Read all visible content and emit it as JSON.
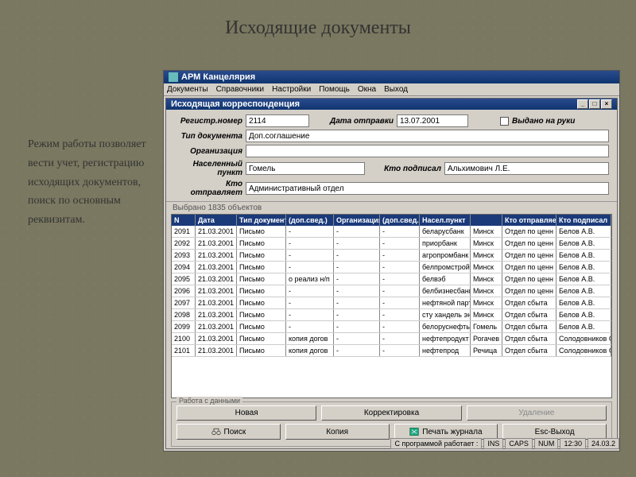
{
  "slide": {
    "title": "Исходящие документы",
    "text": "Режим работы позволяет вести учет, регистрацию исходящих документов, поиск по основным реквизитам."
  },
  "app_title": "АРМ Канцелярия",
  "menu": [
    "Документы",
    "Справочники",
    "Настройки",
    "Помощь",
    "Окна",
    "Выход"
  ],
  "sub_title": "Исходящая корреспонденция",
  "form": {
    "reg_num_lbl": "Регистр.номер",
    "reg_num": "2114",
    "date_lbl": "Дата отправки",
    "date": "13.07.2001",
    "hand_lbl": "Выдано на руки",
    "doc_type_lbl": "Тип документа",
    "doc_type": "Доп.соглашение",
    "org_lbl": "Организация",
    "org": "",
    "city_lbl": "Населенный пункт",
    "city": "Гомель",
    "signer_lbl": "Кто подписал",
    "signer": "Альхимович Л.Е.",
    "sender_lbl": "Кто отправляет",
    "sender": "Административный отдел"
  },
  "grid_status": "Выбрано 1835 объектов",
  "columns": [
    "N",
    "Дата",
    "Тип документа",
    "(доп.свед.)",
    "Организация",
    "(доп.свед.)",
    "Насел.пункт",
    "Кто отправляет",
    "Кто подписал"
  ],
  "rows": [
    {
      "n": "2091",
      "d": "21.03.2001",
      "t": "Письмо",
      "e1": "",
      "o": "",
      "e2": "",
      "c": "беларусбанк",
      "p": "Минск",
      "s": "Отдел по ценн",
      "k": "Белов А.В."
    },
    {
      "n": "2092",
      "d": "21.03.2001",
      "t": "Письмо",
      "e1": "",
      "o": "",
      "e2": "",
      "c": "приорбанк",
      "p": "Минск",
      "s": "Отдел по ценн",
      "k": "Белов А.В."
    },
    {
      "n": "2093",
      "d": "21.03.2001",
      "t": "Письмо",
      "e1": "",
      "o": "",
      "e2": "",
      "c": "агропромбанк",
      "p": "Минск",
      "s": "Отдел по ценн",
      "k": "Белов А.В."
    },
    {
      "n": "2094",
      "d": "21.03.2001",
      "t": "Письмо",
      "e1": "",
      "o": "",
      "e2": "",
      "c": "белпромстрой",
      "p": "Минск",
      "s": "Отдел по ценн",
      "k": "Белов А.В."
    },
    {
      "n": "2095",
      "d": "21.03.2001",
      "t": "Письмо",
      "e1": "о реализ н/п",
      "o": "",
      "e2": "",
      "c": "белвэб",
      "p": "Минск",
      "s": "Отдел по ценн",
      "k": "Белов А.В."
    },
    {
      "n": "2096",
      "d": "21.03.2001",
      "t": "Письмо",
      "e1": "",
      "o": "",
      "e2": "",
      "c": "белбизнесбанк",
      "p": "Минск",
      "s": "Отдел по ценн",
      "k": "Белов А.В."
    },
    {
      "n": "2097",
      "d": "21.03.2001",
      "t": "Письмо",
      "e1": "",
      "o": "",
      "e2": "",
      "c": "нефтяной парт",
      "p": "Минск",
      "s": "Отдел сбыта",
      "k": "Белов А.В."
    },
    {
      "n": "2098",
      "d": "21.03.2001",
      "t": "Письмо",
      "e1": "",
      "o": "",
      "e2": "",
      "c": "сту хандель эн",
      "p": "Минск",
      "s": "Отдел сбыта",
      "k": "Белов А.В."
    },
    {
      "n": "2099",
      "d": "21.03.2001",
      "t": "Письмо",
      "e1": "",
      "o": "",
      "e2": "",
      "c": "белоруснефть",
      "p": "Гомель",
      "s": "Отдел сбыта",
      "k": "Белов А.В."
    },
    {
      "n": "2100",
      "d": "21.03.2001",
      "t": "Письмо",
      "e1": "копия догов",
      "o": "",
      "e2": "",
      "c": "нефтепродукт",
      "p": "Рогачев",
      "s": "Отдел сбыта",
      "k": "Солодовников С.Л."
    },
    {
      "n": "2101",
      "d": "21.03.2001",
      "t": "Письмо",
      "e1": "копия догов",
      "o": "",
      "e2": "",
      "c": "нефтепрод",
      "p": "Речица",
      "s": "Отдел сбыта",
      "k": "Солодовников С.Л."
    }
  ],
  "actions": {
    "group": "Работа с данными",
    "new": "Новая",
    "edit": "Корректировка",
    "del": "Удаление",
    "search": "Поиск",
    "copy": "Копия",
    "print": "Печать журнала",
    "exit": "Esc-Выход"
  },
  "footer": {
    "user": "С программой работает :",
    "ins": "INS",
    "caps": "CAPS",
    "num": "NUM",
    "time": "12:30",
    "date": "24.03.2"
  }
}
